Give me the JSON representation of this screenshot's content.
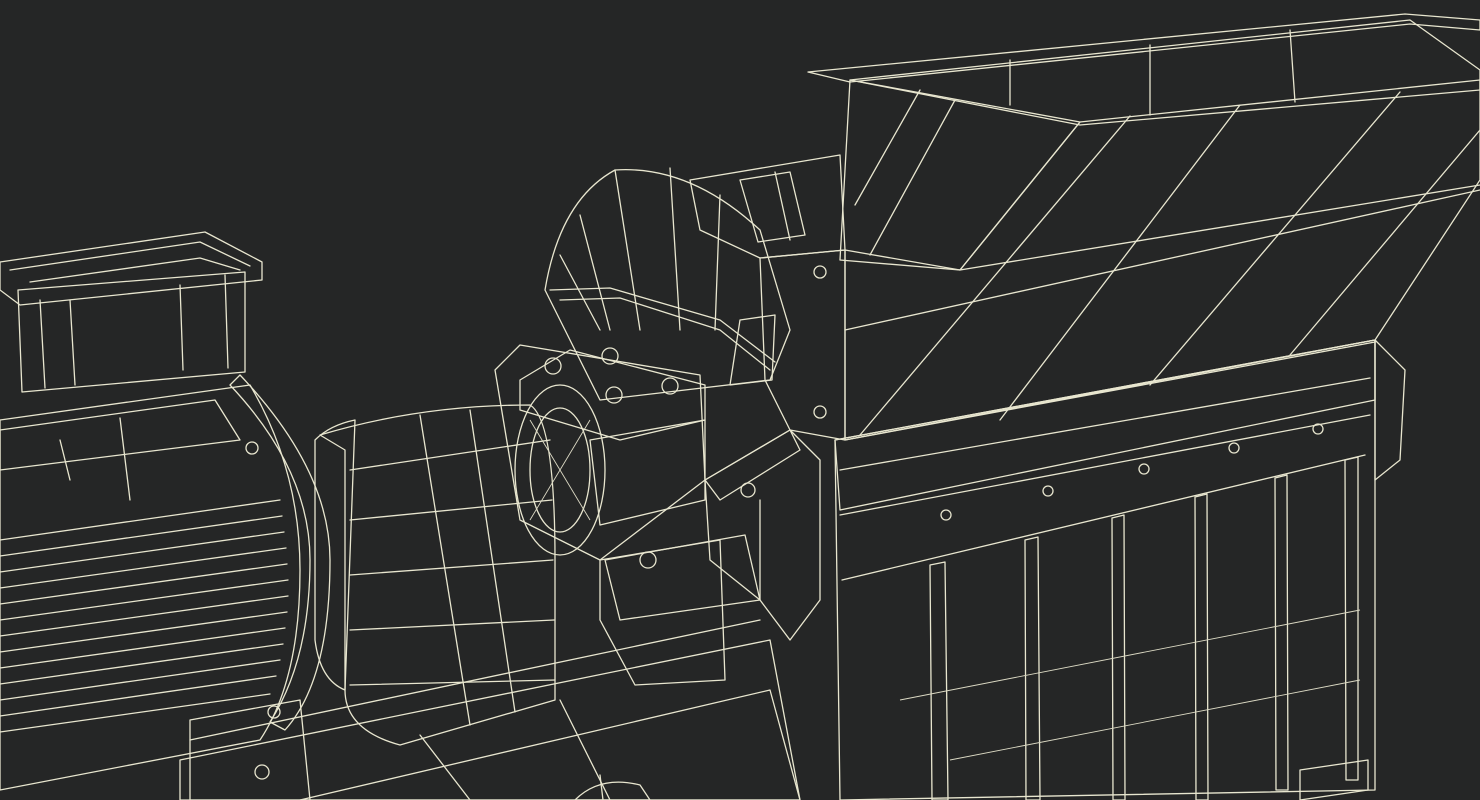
{
  "scene": {
    "background": "#252626",
    "surface_light": "#7d7e76",
    "surface_mid": "#6c6d65",
    "surface_dark": "#55564f",
    "surface_shadow": "#44453f",
    "wire_color": "#e8e6cf"
  }
}
